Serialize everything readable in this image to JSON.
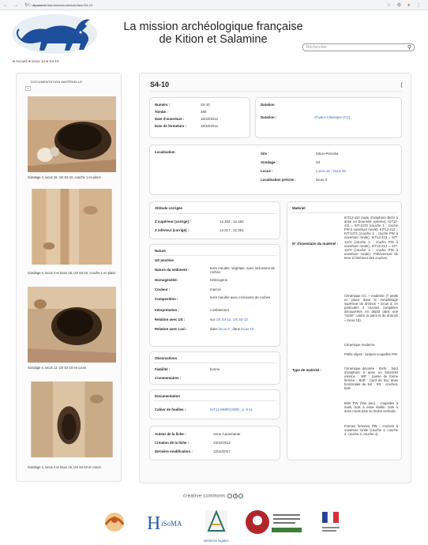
{
  "browser": {
    "url_host": "dipamenti",
    "url_rest": ".fr/archives/eorientale/item/S4-10"
  },
  "header": {
    "title_line1": "La mission archéologique française",
    "title_line2": "de Kition et Salamine",
    "search_placeholder": "Rechercher"
  },
  "breadcrumb": {
    "items": [
      "Accueil",
      "locus 13",
      "S4-10"
    ]
  },
  "sidebar": {
    "heading": "DOCUMENTATION MATÉRIELLE",
    "photos": [
      {
        "caption": "Sondage 4, locus 15, US S4-10, couche 1 en place"
      },
      {
        "caption": "Sondage 4, locus 3 et locus 15, US S4-10, couche 1 en place"
      },
      {
        "caption": "Sondage 4, locus 13, US S4-10 en cours"
      },
      {
        "caption": "Sondage 4, locus 3 et locus 15, US S4-10 en cours"
      }
    ]
  },
  "main": {
    "title": "S4-10",
    "identity": {
      "rows": [
        {
          "label": "Numéro :",
          "value": "S4-10"
        },
        {
          "label": "Tombe :",
          "value": "280"
        },
        {
          "label": "Date d'ouverture :",
          "value": "15/10/2012"
        },
        {
          "label": "Date de fermeture :",
          "value": "15/10/2012"
        }
      ]
    },
    "datation": {
      "title": "Datation",
      "label": "Datation :",
      "value": "Chypro-Classique (CC)"
    },
    "localisation": {
      "title": "Localisation",
      "rows": [
        {
          "label": "Site :",
          "value": "Kition-Pervolia"
        },
        {
          "label": "Sondage :",
          "value": "S4"
        },
        {
          "label": "Locus :",
          "value": "Locus 15 ; locus 03"
        },
        {
          "label": "Localisation précise :",
          "value": "locus 3"
        }
      ]
    },
    "altitude": {
      "title": "Altitude corrigée",
      "rows": [
        {
          "label": "Z supérieur (corrigé) :",
          "value": "12.302 ; 12.452"
        },
        {
          "label": "Z inférieur (corrigé) :",
          "value": "12.217 ; 12.391"
        }
      ]
    },
    "nature": {
      "title": "Nature",
      "us_positive": "US positive",
      "rows": [
        {
          "label": "Nature du sédiment :",
          "value": "terre meuble, végétale, avec inclusions de roches"
        },
        {
          "label": "Homogénéité :",
          "value": "hétérogène"
        },
        {
          "label": "Couleur :",
          "value": "marron"
        },
        {
          "label": "Composition :",
          "value": "terre meuble avec inclusions de roches"
        },
        {
          "label": "Interprétation :",
          "value": "comblement"
        },
        {
          "label": "Relation avec US :",
          "value_pre": "sur ",
          "value_link": "US S4-12, US S4-13"
        },
        {
          "label": "Relation avec Loci :",
          "value_pre": "dans ",
          "value_link": "locus 3",
          "value_mid": " ; dans ",
          "value_link2": "locus 15"
        }
      ]
    },
    "observations": {
      "title": "Observations",
      "rows": [
        {
          "label": "Fiabilité :",
          "value": "bonne"
        },
        {
          "label": "Commentaires :",
          "value": ""
        }
      ]
    },
    "documentation": {
      "title": "Documentation",
      "label": "Cahier de fouilles :",
      "value": "KIT12-MNRCH005 ; p. 9-11"
    },
    "auteur": {
      "rows": [
        {
          "label": "Auteur de la fiche :",
          "value": "Anne Carannante"
        },
        {
          "label": "Création de la fiche :",
          "value": "15/10/2012"
        },
        {
          "label": "Dernière modification :",
          "value": "12/11/2017"
        }
      ]
    },
    "materiel": {
      "title": "Matériel",
      "inventaire_label": "N° d'inventaire du matériel :",
      "inventaire_text": "KIT12-410 (suite d'amphore Bichr à anse en bourrelet externe), KIT12-411 = KIT-1270 (couche 1 ; cruche PW à ouverture ronde), KIT12-412 = KIT-1271 (couche 2 ; cruche PW à ouverture ronde), KIT12-413 = KIT-1272 (couche 3 ; cruche PW à ouverture ronde), KIT12-414 = KIT-1273 (couche 4 ; cruche PW à ouverture ronde). Prélèvement de terre à l'intérieur des cruches.",
      "type_label": "Type de matériel :",
      "type_paras": [
        "Céramique CC + moderne (7 petits en place dans le remplissage supérieur du dromos + locus 3, en particulier 4 cruches complètes découvertes en dépôt dans une \"niche\" contre la paroi N du dromos = locus 15).",
        "Céramique moderne.",
        "Petits objets : lampes-coupelles PW.",
        "Céramique décorée : Bichr : bord d'amphore à anse en bourrelet externe ; WP : panse de forme fermée ; BoR : bord de bol, anse horizontale de bol ; RS : cruches, bols.",
        "Bols PW (fins peu) : coupelles à marli, bols à anse étalée, bols à anse ronde plus ou moins verticale.",
        "Formes fermées PW : cruches à ouverture ronde (couche 1, couche 2, couche 3, couche 4)."
      ]
    }
  },
  "footer": {
    "cc_label": "creative commons",
    "partners": [
      "Mission Kition-Salamine",
      "HiSoMA",
      "Archéologie Orient",
      "Label archéologique",
      "République Française"
    ],
    "legal": "Mentions légales"
  }
}
